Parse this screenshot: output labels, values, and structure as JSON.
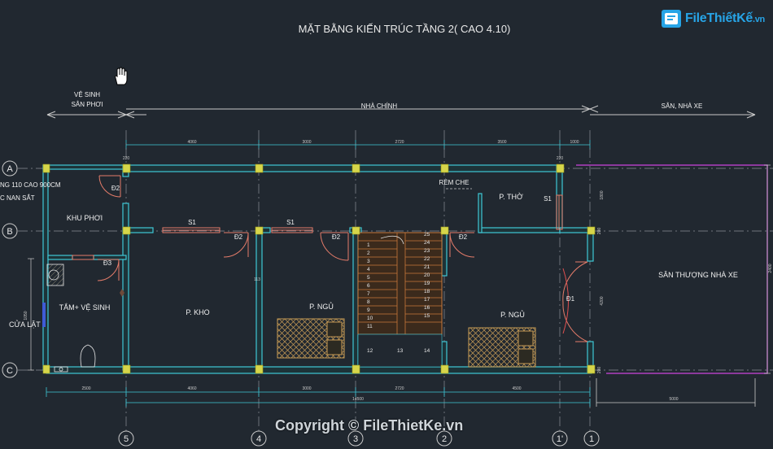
{
  "title": "MẶT BẰNG KIẾN TRÚC TẦNG 2( CAO 4.10)",
  "watermark": {
    "logo_text": "FileThiếtKế",
    "logo_suffix": ".vn",
    "copyright": "Copyright © FileThietKe.vn"
  },
  "zones": {
    "left_line1": "VỆ SINH",
    "left_line2": "SÂN PHƠI",
    "middle": "NHÀ CHÍNH",
    "right": "SÂN, NHÀ XE"
  },
  "axes": {
    "row_a": "A",
    "row_b": "B",
    "row_c": "C",
    "col_5": "5",
    "col_4": "4",
    "col_3": "3",
    "col_2": "2",
    "col_1p": "1'",
    "col_1": "1"
  },
  "dims_top": [
    "4060",
    "3000",
    "2720",
    "3500",
    "1000"
  ],
  "dims_top_small": [
    "220",
    "220"
  ],
  "dims_bottom": [
    "2500",
    "4060",
    "3000",
    "2720",
    "4500"
  ],
  "dim_total": "14500",
  "dim_right_bottom": "5000",
  "dims_side": [
    "1800",
    "2400",
    "4200",
    "200",
    "200",
    "113",
    "1050"
  ],
  "rooms": {
    "khu_phoi": "KHU PHƠI",
    "tam_ve_sinh": "TẮM+ VỆ SINH",
    "p_kho": "P. KHO",
    "p_ngu_1": "P. NGỦ",
    "p_ngu_2": "P. NGỦ",
    "p_tho": "P. THỜ",
    "san_thuong": "SÂN THƯỢNG NHÀ XE",
    "rem_che": "RÈM CHE"
  },
  "notes": {
    "note_1": "NG 110 CAO 900CM",
    "note_2": "C NAN SẮT",
    "cua_lat": "CỬA LẬT"
  },
  "door_labels": {
    "d2_a": "Đ2",
    "d3": "Đ3",
    "d2_b": "Đ2",
    "d2_c": "Đ2",
    "d2_d": "Đ2",
    "d1": "Đ1",
    "s1_a": "S1",
    "s1_b": "S1",
    "s1_c": "S1"
  },
  "stair_steps_left": [
    "1",
    "2",
    "3",
    "4",
    "5",
    "6",
    "7",
    "8",
    "9",
    "10",
    "11",
    "12"
  ],
  "stair_mid": "13",
  "stair_steps_right": [
    "25",
    "24",
    "23",
    "22",
    "21",
    "20",
    "19",
    "18",
    "17",
    "16",
    "15",
    "14"
  ],
  "colors": {
    "background": "#212830",
    "wall": "#3fc7d6",
    "column": "#d6d64a",
    "door": "#e57c6a",
    "dimension": "#3fc7d6",
    "stair": "#c8783a",
    "boundary": "#b03fbf",
    "window": "#e57c6a",
    "brand": "#27a4e6"
  }
}
